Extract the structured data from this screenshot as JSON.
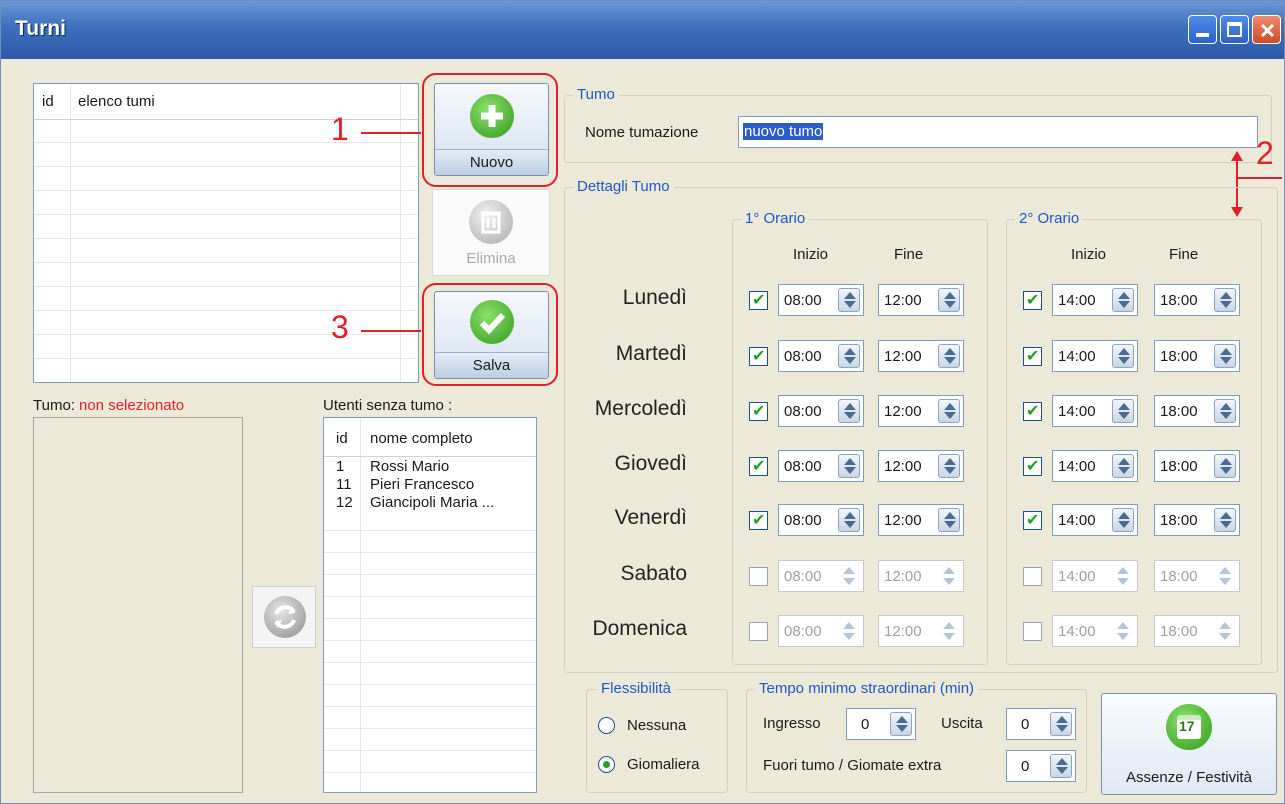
{
  "window": {
    "title": "Turni"
  },
  "list_turni": {
    "col_id": "id",
    "col_name": "elenco tumi"
  },
  "buttons": {
    "nuovo": "Nuovo",
    "elimina": "Elimina",
    "salva": "Salva",
    "assenze": "Assenze / Festività"
  },
  "annotations": {
    "a1": "1",
    "a2": "2",
    "a3": "3"
  },
  "turno_sel": {
    "label": "Tumo:",
    "value": "non selezionato"
  },
  "utenti": {
    "title": "Utenti senza tumo :",
    "col_id": "id",
    "col_name": "nome completo",
    "rows": [
      {
        "id": "1",
        "name": "Rossi Mario"
      },
      {
        "id": "11",
        "name": "Pieri Francesco"
      },
      {
        "id": "12",
        "name": "Giancipoli Maria ..."
      }
    ]
  },
  "turno": {
    "group_title": "Tumo",
    "name_label": "Nome tumazione",
    "name_value": "nuovo tumo"
  },
  "dettagli": {
    "group_title": "Dettagli Tumo",
    "orario1": "1° Orario",
    "orario2": "2° Orario",
    "inizio": "Inizio",
    "fine": "Fine",
    "days": [
      {
        "name": "Lunedì",
        "enabled": true,
        "s1": "08:00",
        "e1": "12:00",
        "s2": "14:00",
        "e2": "18:00"
      },
      {
        "name": "Martedì",
        "enabled": true,
        "s1": "08:00",
        "e1": "12:00",
        "s2": "14:00",
        "e2": "18:00"
      },
      {
        "name": "Mercoledì",
        "enabled": true,
        "s1": "08:00",
        "e1": "12:00",
        "s2": "14:00",
        "e2": "18:00"
      },
      {
        "name": "Giovedì",
        "enabled": true,
        "s1": "08:00",
        "e1": "12:00",
        "s2": "14:00",
        "e2": "18:00"
      },
      {
        "name": "Venerdì",
        "enabled": true,
        "s1": "08:00",
        "e1": "12:00",
        "s2": "14:00",
        "e2": "18:00"
      },
      {
        "name": "Sabato",
        "enabled": false,
        "s1": "08:00",
        "e1": "12:00",
        "s2": "14:00",
        "e2": "18:00"
      },
      {
        "name": "Domenica",
        "enabled": false,
        "s1": "08:00",
        "e1": "12:00",
        "s2": "14:00",
        "e2": "18:00"
      }
    ]
  },
  "flessibilita": {
    "title": "Flessibilità",
    "opt1": "Nessuna",
    "opt2": "Giomaliera",
    "selected": "Giomaliera"
  },
  "straordinari": {
    "title": "Tempo minimo straordinari  (min)",
    "ingresso": "Ingresso",
    "ingresso_val": "0",
    "uscita": "Uscita",
    "uscita_val": "0",
    "fuori": "Fuori tumo  /  Giomate extra",
    "fuori_val": "0"
  },
  "calendar_icon_text": "17",
  "colors": {
    "accent_blue": "#1d57c8",
    "red": "#e0202a",
    "green": "#21a121"
  }
}
